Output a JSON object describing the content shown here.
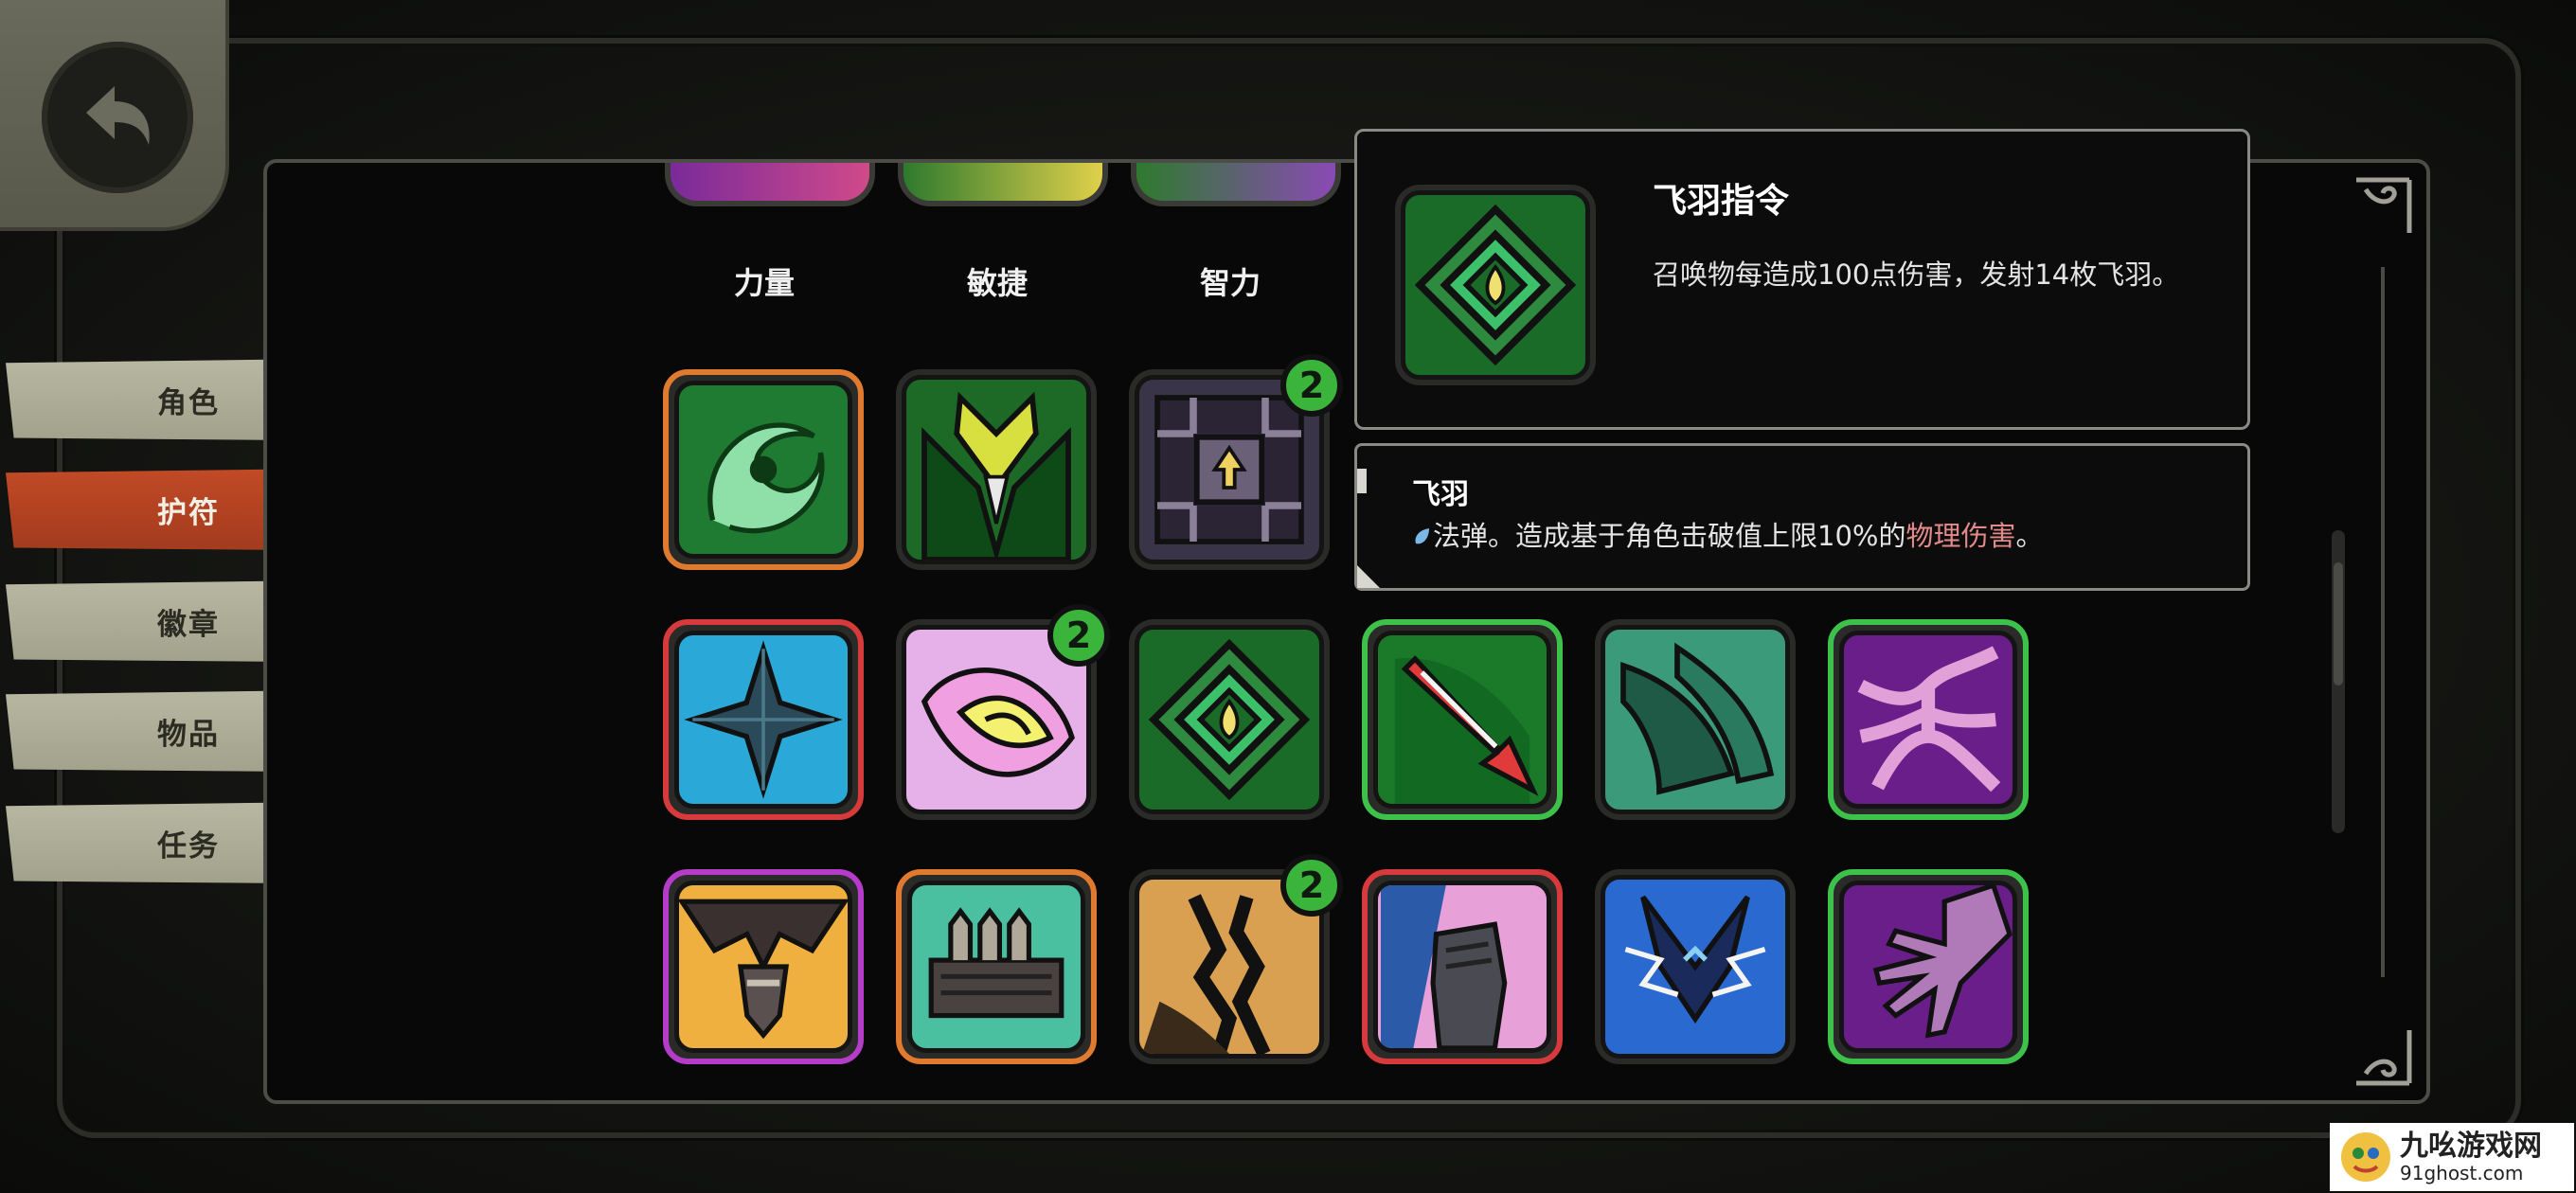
{
  "stats": {
    "strength": "力量",
    "agility": "敏捷",
    "intelligence": "智力"
  },
  "menu": {
    "items": [
      {
        "label": "角色",
        "active": false
      },
      {
        "label": "护符",
        "active": true
      },
      {
        "label": "徽章",
        "active": false
      },
      {
        "label": "物品",
        "active": false
      },
      {
        "label": "任务",
        "active": false
      }
    ]
  },
  "badges": {
    "count_a": "2",
    "count_b": "2",
    "count_c": "2"
  },
  "tooltip": {
    "title": "飞羽指令",
    "description": "召唤物每造成100点伤害，发射14枚飞羽。"
  },
  "skill": {
    "name": "飞羽",
    "desc_prefix": "法弹。造成基于角色击破值上限10%的",
    "desc_highlight": "物理伤害",
    "desc_suffix": "。"
  },
  "watermark": {
    "name": "九吆游戏网",
    "url": "91ghost.com"
  },
  "colors": {
    "active_tab": "#b8431f",
    "inactive_tab": "#b0b09a",
    "badge_green": "#3bb43b",
    "rarity_orange": "#e07a2e",
    "rarity_red": "#d63a3a",
    "rarity_green": "#3cc24a",
    "rarity_purple": "#b43cc8",
    "damage_highlight": "#e28a8a"
  }
}
